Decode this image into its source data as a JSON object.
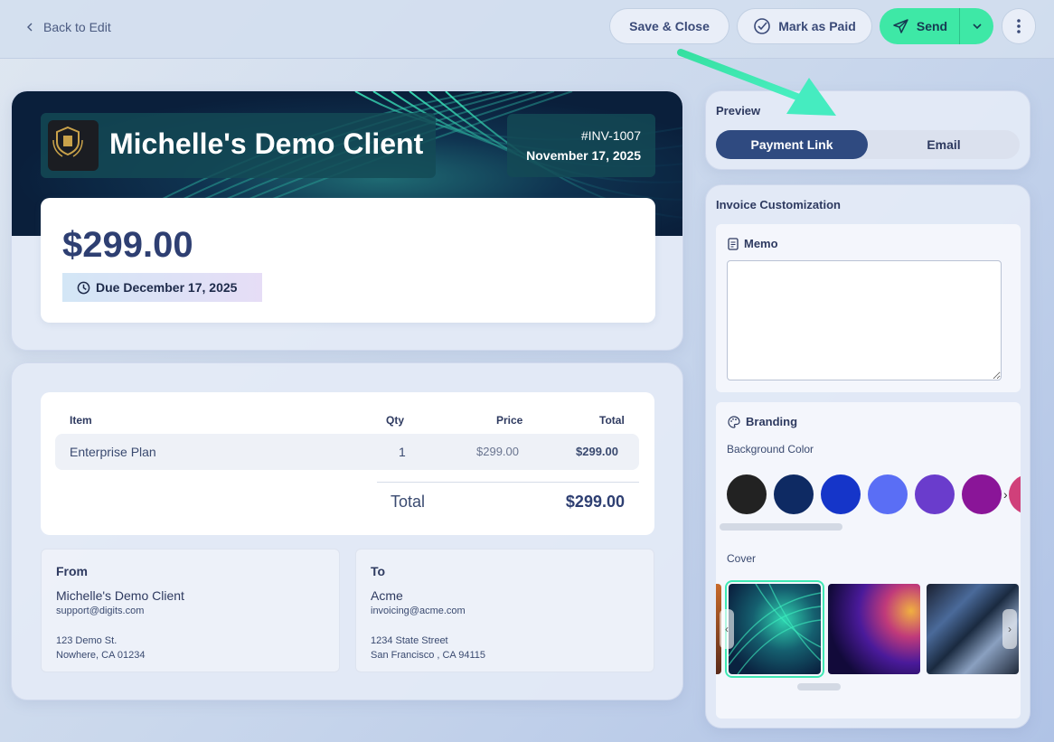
{
  "topbar": {
    "back_label": "Back to Edit",
    "save_close": "Save & Close",
    "mark_paid": "Mark as Paid",
    "send": "Send"
  },
  "invoice": {
    "client_name": "Michelle's Demo Client",
    "number": "#INV-1007",
    "date": "November 17, 2025",
    "amount": "$299.00",
    "due": "Due December 17, 2025"
  },
  "table": {
    "headers": [
      "Item",
      "Qty",
      "Price",
      "Total"
    ],
    "rows": [
      {
        "item": "Enterprise Plan",
        "qty": "1",
        "price": "$299.00",
        "total": "$299.00"
      }
    ],
    "total_label": "Total",
    "total_value": "$299.00"
  },
  "from": {
    "title": "From",
    "name": "Michelle's Demo Client",
    "email": "support@digits.com",
    "address_line1": "123 Demo St.",
    "address_line2": "Nowhere, CA 01234"
  },
  "to": {
    "title": "To",
    "name": "Acme",
    "email": "invoicing@acme.com",
    "address_line1": "1234 State Street",
    "address_line2": "San Francisco , CA 94115"
  },
  "preview": {
    "title": "Preview",
    "options": [
      "Payment Link",
      "Email"
    ],
    "selected": "Payment Link"
  },
  "customization": {
    "title": "Invoice Customization",
    "memo_title": "Memo",
    "memo_value": "",
    "branding_title": "Branding",
    "background_label": "Background Color",
    "background_colors": [
      "#222222",
      "#0e2a63",
      "#1535c9",
      "#5a6ef5",
      "#6a3ccc",
      "#8a1598",
      "#d0407a"
    ],
    "cover_label": "Cover"
  },
  "colors": {
    "accent": "#3ee8a6",
    "primary_dark": "#2f4a80"
  }
}
